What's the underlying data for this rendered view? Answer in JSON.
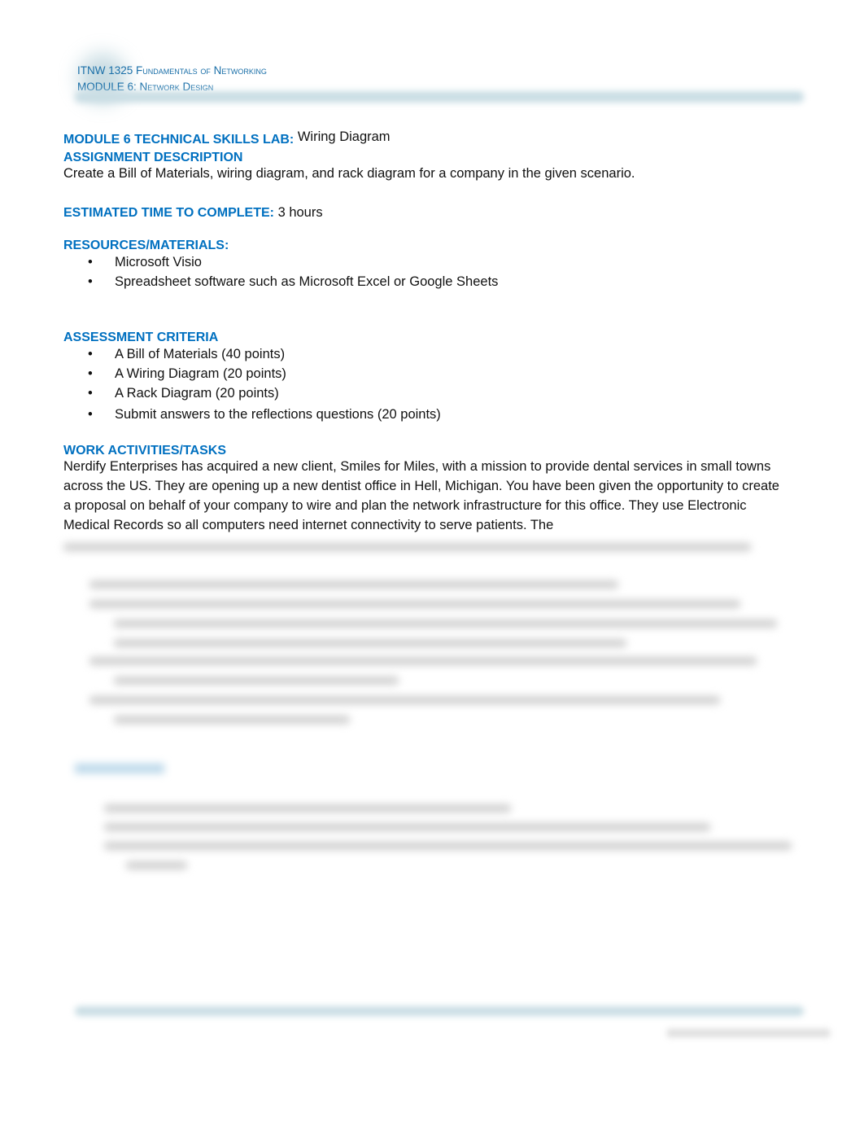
{
  "header": {
    "course_code": "ITNW 1325",
    "course_name": "Fundamentals of Networking",
    "module": "MODULE 6:",
    "module_name": "Network Design"
  },
  "lab": {
    "label": "MODULE 6 TECHNICAL SKILLS LAB:",
    "title": "Wiring Diagram"
  },
  "assignment": {
    "heading": "ASSIGNMENT DESCRIPTION",
    "text": "Create a Bill of Materials, wiring diagram, and rack diagram for a company in the given scenario."
  },
  "time": {
    "label": "ESTIMATED TIME TO COMPLETE:",
    "value": "3 hours"
  },
  "resources": {
    "heading": "RESOURCES/MATERIALS:",
    "items": [
      "Microsoft Visio",
      "Spreadsheet software such as Microsoft Excel or Google Sheets"
    ]
  },
  "assessment": {
    "heading": "ASSESSMENT CRITERIA",
    "items": [
      "A Bill of Materials (40 points)",
      "A Wiring Diagram (20 points)",
      "A Rack Diagram (20 points)",
      "Submit answers to the reflections questions (20 points)"
    ]
  },
  "work": {
    "heading": "WORK ACTIVITIES/TASKS",
    "text": "Nerdify Enterprises has acquired a new client, Smiles for Miles, with a mission to provide dental services in small towns across the US. They are opening up a new dentist office in Hell, Michigan. You have been given the opportunity to create a proposal on behalf of your company to wire and plan the network infrastructure for this office. They use Electronic Medical Records so all computers need internet connectivity to serve patients. The"
  }
}
